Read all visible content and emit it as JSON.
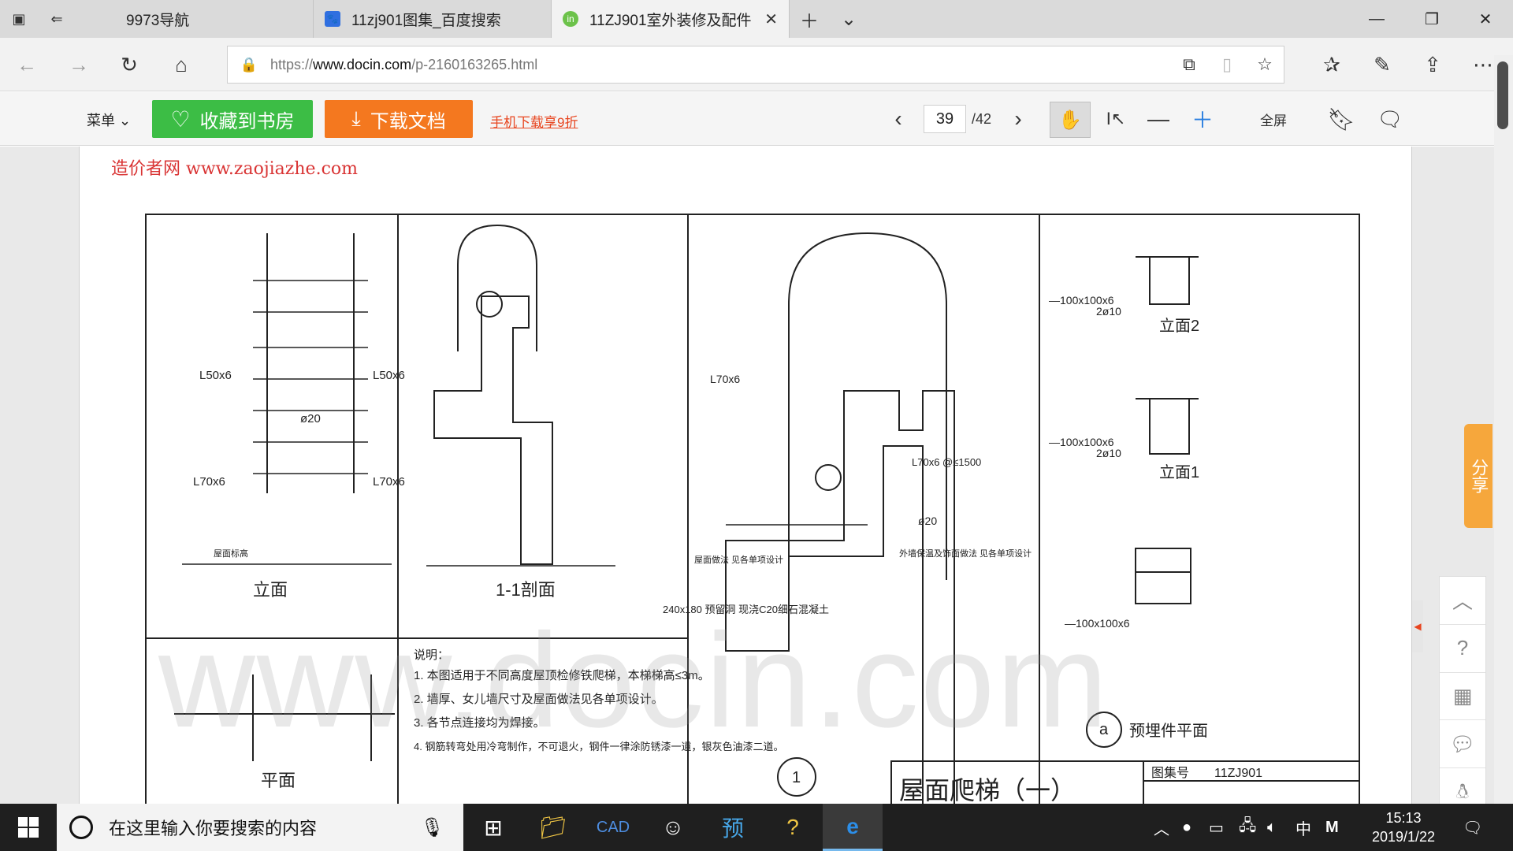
{
  "browser": {
    "tabs": [
      {
        "label": "9973导航",
        "active": false
      },
      {
        "label": "11zj901图集_百度搜索",
        "active": false
      },
      {
        "label": "11ZJ901室外装修及配件",
        "active": true
      }
    ],
    "address": {
      "prefix": "https://",
      "domain": "www.docin.com",
      "path": "/p-2160163265.html"
    }
  },
  "toolbar": {
    "menu_label": "菜单",
    "collect_label": "收藏到书房",
    "download_label": "下载文档",
    "mobile_link": "手机下载享9折",
    "page_current": "39",
    "page_total": "/42",
    "fullscreen_label": "全屏"
  },
  "document": {
    "site_watermark": "造价者网 www.zaojiazhe.com",
    "big_watermark": "www.docin.com",
    "drawing": {
      "view_elevation": "立面",
      "view_section": "1-1剖面",
      "view_plan": "平面",
      "elev2": "立面2",
      "elev1": "立面1",
      "embed_plan": "预埋件平面",
      "title_block": "屋面爬梯（一）",
      "atlas_label": "图集号",
      "atlas_no": "11ZJ901",
      "notes_title": "说明：",
      "notes": [
        "1. 本图适用于不同高度屋顶检修铁爬梯，本梯梯高≤3m。",
        "2. 墙厚、女儿墙尺寸及屋面做法见各单项设计。",
        "3. 各节点连接均为焊接。",
        "4. 钢筋转弯处用冷弯制作，不可退火，钢件一律涂防锈漆一道，银灰色油漆二道。"
      ],
      "labels": {
        "l50": "L50x6",
        "l70": "L70x6",
        "d20": "ø20",
        "d10": "2ø10",
        "plate": "—100x100x6",
        "roof_level": "屋面标高",
        "embed": "240x180 预留洞 现浇C20细石混凝土",
        "roof_work": "屋面做法 见各单项设计",
        "wall_work": "外墙保温及饰面做法 见各单项设计",
        "circle_a": "a",
        "circle_1": "1",
        "l70_1500": "L70x6 @≤1500"
      }
    }
  },
  "side_panel": {
    "share_label": "分享"
  },
  "taskbar": {
    "search_placeholder": "在这里输入你要搜索的内容",
    "ime": "中",
    "time": "15:13",
    "date": "2019/1/22"
  }
}
